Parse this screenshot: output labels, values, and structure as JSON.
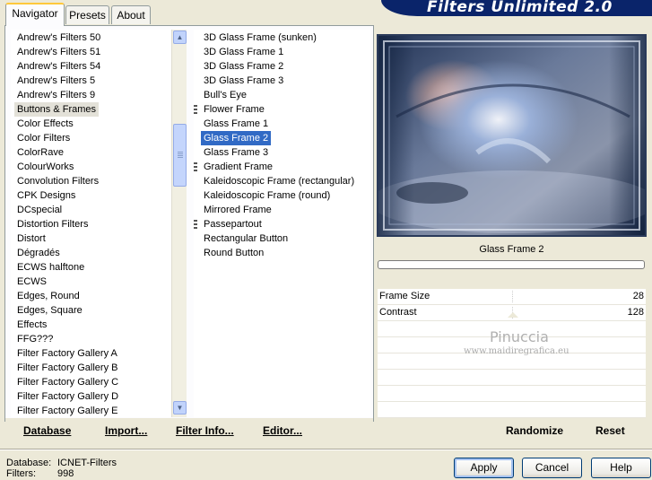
{
  "tabs": [
    {
      "label": "Navigator",
      "active": true
    },
    {
      "label": "Presets",
      "active": false
    },
    {
      "label": "About",
      "active": false
    }
  ],
  "header": {
    "title": "Filters Unlimited 2.0"
  },
  "categories": {
    "items": [
      "Andrew's Filters 50",
      "Andrew's Filters 51",
      "Andrew's Filters 54",
      "Andrew's Filters 5",
      "Andrew's Filters 9",
      "Buttons & Frames",
      "Color Effects",
      "Color Filters",
      "ColorRave",
      "ColourWorks",
      "Convolution Filters",
      "CPK Designs",
      "DCspecial",
      "Distortion Filters",
      "Distort",
      "Dégradés",
      "ECWS halftone",
      "ECWS",
      "Edges, Round",
      "Edges, Square",
      "Effects",
      "FFG???",
      "Filter Factory Gallery A",
      "Filter Factory Gallery B",
      "Filter Factory Gallery C",
      "Filter Factory Gallery D",
      "Filter Factory Gallery E"
    ],
    "selected_index": 5
  },
  "filters": {
    "items": [
      {
        "label": "3D Glass Frame (sunken)",
        "grip": false
      },
      {
        "label": "3D Glass Frame 1",
        "grip": false
      },
      {
        "label": "3D Glass Frame 2",
        "grip": false
      },
      {
        "label": "3D Glass Frame 3",
        "grip": false
      },
      {
        "label": "Bull's Eye",
        "grip": false
      },
      {
        "label": "Flower Frame",
        "grip": true
      },
      {
        "label": "Glass Frame 1",
        "grip": false
      },
      {
        "label": "Glass Frame 2",
        "grip": false
      },
      {
        "label": "Glass Frame 3",
        "grip": false
      },
      {
        "label": "Gradient Frame",
        "grip": true
      },
      {
        "label": "Kaleidoscopic Frame (rectangular)",
        "grip": false
      },
      {
        "label": "Kaleidoscopic Frame (round)",
        "grip": false
      },
      {
        "label": "Mirrored Frame",
        "grip": false
      },
      {
        "label": "Passepartout",
        "grip": true
      },
      {
        "label": "Rectangular Button",
        "grip": false
      },
      {
        "label": "Round Button",
        "grip": false
      }
    ],
    "selected_index": 7
  },
  "preview": {
    "filter_name": "Glass Frame 2",
    "progress": 0
  },
  "params": [
    {
      "label": "Frame Size",
      "value": "28"
    },
    {
      "label": "Contrast",
      "value": "128"
    }
  ],
  "watermark": {
    "name": "Pinuccia",
    "site": "www.maidiregrafica.eu"
  },
  "left_bar": {
    "database": "Database",
    "import": "Import...",
    "filter_info": "Filter Info...",
    "editor": "Editor..."
  },
  "right_bar": {
    "randomize": "Randomize",
    "reset": "Reset"
  },
  "status": {
    "db_label": "Database:",
    "db_value": "ICNET-Filters",
    "filters_label": "Filters:",
    "filters_value": "998"
  },
  "buttons": {
    "apply": "Apply",
    "cancel": "Cancel",
    "help": "Help"
  },
  "colors": {
    "selection": "#316ac5",
    "header_bg": "#0a246a",
    "panel": "#ece9d8"
  }
}
